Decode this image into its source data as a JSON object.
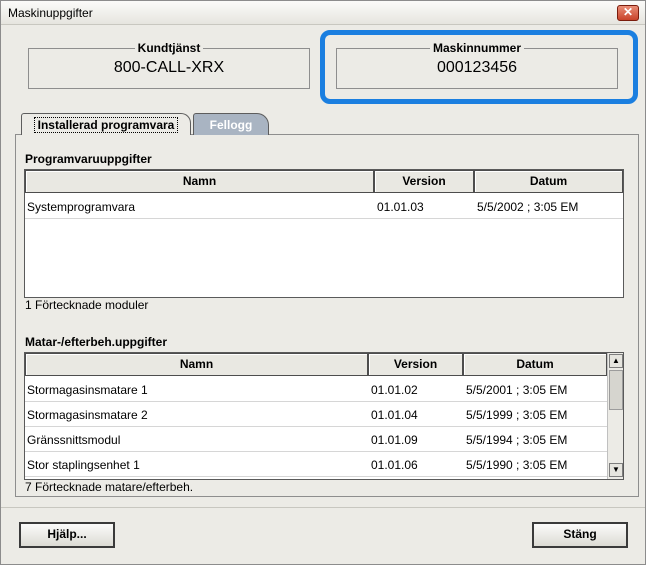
{
  "window": {
    "title": "Maskinuppgifter",
    "close_glyph": "✕"
  },
  "customer_service": {
    "label": "Kundtjänst",
    "value": "800-CALL-XRX"
  },
  "machine_number": {
    "label": "Maskinnummer",
    "value": "000123456"
  },
  "tabs": [
    {
      "label": "Installerad programvara",
      "active": true
    },
    {
      "label": "Fellogg",
      "active": false
    }
  ],
  "software": {
    "title": "Programvaruuppgifter",
    "columns": [
      "Namn",
      "Version",
      "Datum"
    ],
    "rows": [
      {
        "name": "Systemprogramvara",
        "version": "01.01.03",
        "date": "5/5/2002 ; 3:05 EM"
      }
    ],
    "footer": "1 Förtecknade moduler"
  },
  "feeders": {
    "title": "Matar-/efterbeh.uppgifter",
    "columns": [
      "Namn",
      "Version",
      "Datum"
    ],
    "rows": [
      {
        "name": "Stormagasinsmatare 1",
        "version": "01.01.02",
        "date": "5/5/2001 ; 3:05 EM"
      },
      {
        "name": "Stormagasinsmatare 2",
        "version": "01.01.04",
        "date": "5/5/1999 ; 3:05 EM"
      },
      {
        "name": "Gränssnittsmodul",
        "version": "01.01.09",
        "date": "5/5/1994 ; 3:05 EM"
      },
      {
        "name": "Stor staplingsenhet 1",
        "version": "01.01.06",
        "date": "5/5/1990 ; 3:05 EM"
      }
    ],
    "footer": "7 Förtecknade matare/efterbeh."
  },
  "buttons": {
    "help": "Hjälp...",
    "close": "Stäng"
  },
  "colors": {
    "highlight": "#1b7fe0",
    "inactive_tab": "#a9b4c2",
    "close_button": "#c8432a"
  }
}
